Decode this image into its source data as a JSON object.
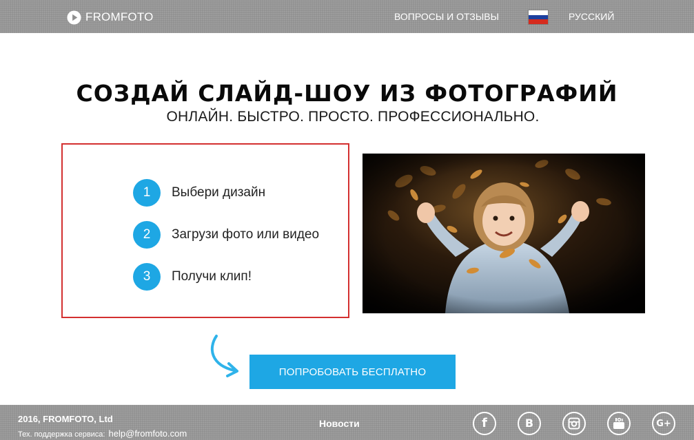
{
  "header": {
    "logo_text": "FROMFOTO",
    "nav_faq": "ВОПРОСЫ И ОТЗЫВЫ",
    "language": "РУССКИЙ",
    "flag_colors": [
      "#ffffff",
      "#1c3f9e",
      "#d52b1e"
    ]
  },
  "hero": {
    "title": "СОЗДАЙ СЛАЙД-ШОУ ИЗ ФОТОГРАФИЙ",
    "subtitle": "ОНЛАЙН. БЫСТРО. ПРОСТО. ПРОФЕССИОНАЛЬНО."
  },
  "steps": [
    {
      "num": "1",
      "label": "Выбери дизайн"
    },
    {
      "num": "2",
      "label": "Загрузи фото или видео"
    },
    {
      "num": "3",
      "label": "Получи клип!"
    }
  ],
  "cta": {
    "label": "ПОПРОБОВАТЬ БЕСПЛАТНО"
  },
  "footer": {
    "copyright": "2016, FROMFOTO, Ltd",
    "support_label": "Тех. поддержка сервиса:",
    "support_email": "help@fromfoto.com",
    "news": "Новости",
    "social": [
      {
        "name": "facebook-icon",
        "glyph": "f"
      },
      {
        "name": "vk-icon",
        "glyph": "B"
      },
      {
        "name": "instagram-icon",
        "glyph": ""
      },
      {
        "name": "youtube-icon",
        "glyph": ""
      },
      {
        "name": "google-plus-icon",
        "glyph": "G+"
      }
    ]
  },
  "colors": {
    "accent": "#1ea7e4",
    "steps_border": "#d32f2f",
    "bar_gray": "#8f8f8f"
  }
}
